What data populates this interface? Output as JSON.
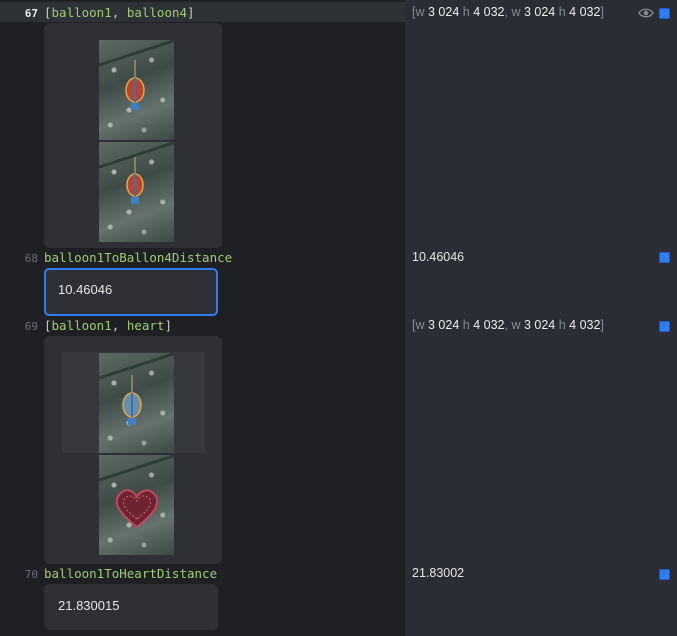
{
  "lines": [
    {
      "number": "67",
      "code_open": "[",
      "code_a": "balloon1",
      "code_sep": ", ",
      "code_b": "balloon4",
      "code_close": "]",
      "result": {
        "open": "[",
        "w_label": "w",
        "w1": "3 024",
        "h_label": "h",
        "h1": "4 032",
        "sep": ", ",
        "w2": "3 024",
        "h2": "4 032",
        "close": "]"
      }
    },
    {
      "number": "68",
      "code": "balloon1ToBallon4Distance",
      "value_box": "10.46046",
      "result": "10.46046"
    },
    {
      "number": "69",
      "code_open": "[",
      "code_a": "balloon1",
      "code_sep": ", ",
      "code_b": "heart",
      "code_close": "]",
      "result": {
        "open": "[",
        "w_label": "w",
        "w1": "3 024",
        "h_label": "h",
        "h1": "4 032",
        "sep": ", ",
        "w2": "3 024",
        "h2": "4 032",
        "close": "]"
      }
    },
    {
      "number": "70",
      "code": "balloon1ToHeartDistance",
      "value_box": "21.830015",
      "result": "21.83002"
    }
  ],
  "icons": {
    "eye": "eye-icon",
    "pin": "pin-result-icon",
    "balloon": "hot-air-balloon-ornament",
    "heart": "heart-ornament"
  },
  "colors": {
    "editor_bg": "#1f2024",
    "results_bg": "#2b2d34",
    "accent": "#2f7cf5",
    "identifier": "#9fcb72"
  }
}
